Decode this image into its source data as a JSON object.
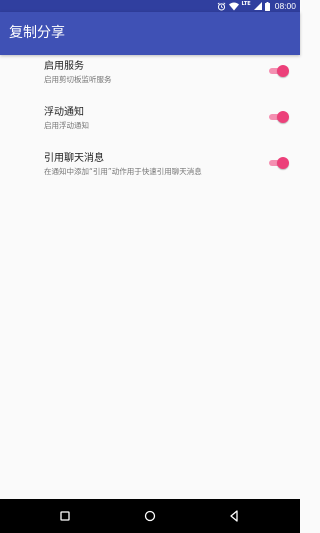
{
  "status_bar": {
    "network_type": "LTE",
    "time": "08:00",
    "icons": [
      "alarm-icon",
      "wifi-icon",
      "cellular-signal-icon",
      "battery-icon"
    ]
  },
  "app_bar": {
    "title": "复制分享"
  },
  "settings": {
    "items": [
      {
        "title": "启用服务",
        "summary": "启用剪切板监听服务",
        "enabled": true
      },
      {
        "title": "浮动通知",
        "summary": "启用浮动通知",
        "enabled": true
      },
      {
        "title": "引用聊天消息",
        "summary": "在通知中添加“引用”动作用于快速引用聊天消息",
        "enabled": true
      }
    ]
  },
  "navigation": {
    "buttons": [
      "recents-icon",
      "home-icon",
      "back-icon"
    ]
  },
  "colors": {
    "status_bar": "#303f9f",
    "app_bar": "#3f51b5",
    "toggle_thumb": "#ec407a",
    "toggle_track": "#f48fb1",
    "background": "#fafafa"
  }
}
